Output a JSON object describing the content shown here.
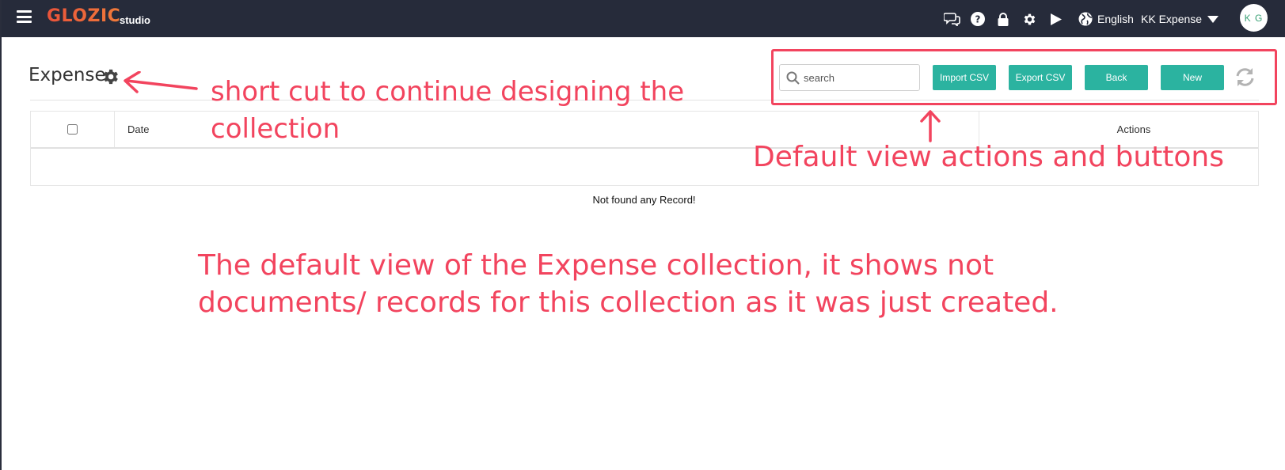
{
  "topbar": {
    "logo": "GLOZIC",
    "logo_sub": "studio",
    "icons": [
      "chat-icon",
      "help-icon",
      "lock-icon",
      "gear-icon",
      "play-icon",
      "globe-icon"
    ],
    "language": "English",
    "workspace": "KK Expense",
    "avatar_initials": "K G"
  },
  "page": {
    "title": "Expense"
  },
  "toolbar": {
    "search_placeholder": "search",
    "import_label": "Import CSV",
    "export_label": "Export CSV",
    "back_label": "Back",
    "new_label": "New"
  },
  "table": {
    "columns": [
      "Date",
      "Actions"
    ],
    "empty_message": "Not found any Record!"
  },
  "annotations": {
    "shortcut_note": "short cut to continue designing the collection",
    "toolbar_note": "Default view actions and buttons",
    "view_note": "The default view of the Expense collection, it shows not documents/ records for this collection as it was just created."
  },
  "colors": {
    "topbar_bg": "#262b3a",
    "accent": "#2bb3a0",
    "annotation": "#f2445e",
    "logo": "#e9533a"
  }
}
